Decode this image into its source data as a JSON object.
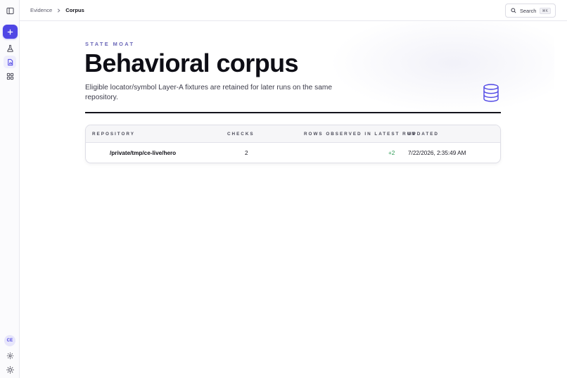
{
  "breadcrumb": {
    "parent": "Evidence",
    "current": "Corpus"
  },
  "search": {
    "label": "Search",
    "shortcut": "⌘K"
  },
  "sidebar": {
    "icons": [
      "sidebar-toggle-icon",
      "plus-icon",
      "flask-icon",
      "file-chart-icon",
      "grid-icon",
      "gear-icon",
      "sun-icon"
    ],
    "avatar_initials": "CE"
  },
  "page": {
    "eyebrow": "STATE MOAT",
    "title": "Behavioral corpus",
    "description": "Eligible locator/symbol Layer-A fixtures are retained for later runs on the same repository."
  },
  "table": {
    "columns": [
      "REPOSITORY",
      "CHECKS",
      "ROWS OBSERVED IN LATEST RUN",
      "UPDATED"
    ],
    "rows": [
      {
        "repository": "/private/tmp/ce-live/hero",
        "checks": "2",
        "rows_observed": "+2",
        "updated": "7/22/2026, 2:35:49 AM"
      }
    ]
  },
  "colors": {
    "accent": "#4f46e5",
    "positive": "#2e9b55",
    "text": "#0e0e16"
  }
}
